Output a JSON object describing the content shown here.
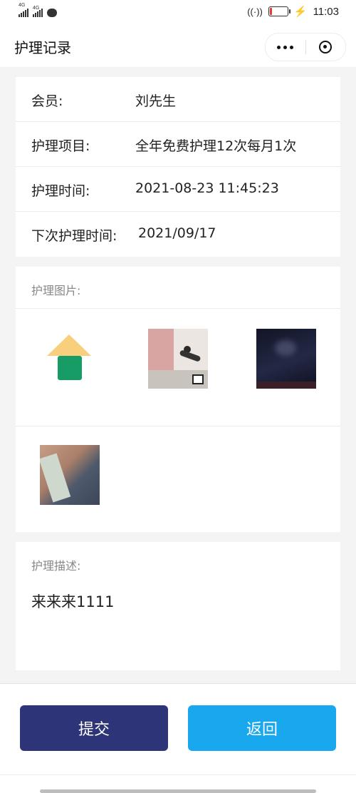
{
  "status_bar": {
    "network_1": "4G",
    "network_2": "4G",
    "time": "11:03"
  },
  "header": {
    "title": "护理记录"
  },
  "info": {
    "member_label": "会员:",
    "member_value": "刘先生",
    "item_label": "护理项目:",
    "item_value": "全年免费护理12次每月1次",
    "time_label": "护理时间:",
    "time_value": "2021-08-23 11:45:23",
    "next_label": "下次护理时间:",
    "next_value": "2021/09/17"
  },
  "images": {
    "title": "护理图片:",
    "items": [
      "house-placeholder-icon",
      "yoga-photo",
      "dark-photo",
      "personal-photo"
    ]
  },
  "description": {
    "title": "护理描述:",
    "text": "来来来1111"
  },
  "actions": {
    "submit_label": "提交",
    "back_label": "返回"
  },
  "colors": {
    "submit_bg": "#2e3478",
    "back_bg": "#19a7ee",
    "battery_low": "#e53935"
  }
}
